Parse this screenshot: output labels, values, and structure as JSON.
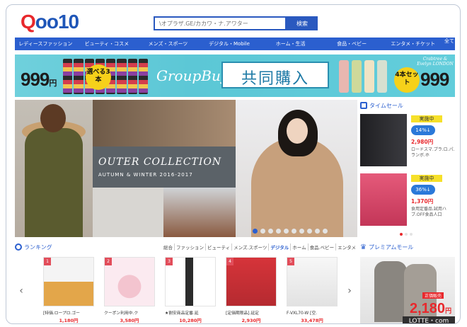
{
  "logo": {
    "q": "Q",
    "rest": "oo10"
  },
  "search": {
    "placeholder": "\\オプラザ.GE/カカワ・ナ.アワター",
    "button": "検索"
  },
  "nav": [
    "レディースファッション",
    "ビューティ・コスメ",
    "メンズ・スポーツ",
    "デジタル・Mobile",
    "ホーム・生活",
    "食品・ベビー",
    "エンタメ・チケット"
  ],
  "nav_more": "全て",
  "banner": {
    "price_left": "999",
    "price_unit": "円",
    "badge_left": "選べる3本",
    "groupbuy": "GroupBuy",
    "kyodo": "共同購入",
    "brand": "Crabtree & Evelyn LONDON",
    "badge_right": "4本セット",
    "price_right": "999"
  },
  "hero": {
    "title": "OUTER COLLECTION",
    "subtitle": "AUTUMN & WINTER 2016-2017",
    "slide_count": 10,
    "active_slide": 0
  },
  "timesale": {
    "title": "タイムセール",
    "items": [
      {
        "status": "実施中",
        "discount": "14%↓",
        "price": "2,980円",
        "desc": "ロードスマ.プラ.ロ.パ.ランボ.ホ"
      },
      {
        "status": "実施中",
        "discount": "36%↓",
        "price": "1,370円",
        "desc": "食用定番品.試用ハブ.OFF食品人口"
      }
    ]
  },
  "ranking": {
    "title": "ランキング",
    "categories": [
      "総合",
      "ファッション",
      "ビューティ",
      "メンズ.スポーツ",
      "デジタル",
      "ホーム",
      "食品.ベビー",
      "エンタメ"
    ],
    "active_category": 4,
    "items": [
      {
        "rank": "1",
        "name": "[特価.ロープロ.ゴー",
        "price": "1,180円"
      },
      {
        "rank": "2",
        "name": "クーポン利用中.ク",
        "price": "3,580円"
      },
      {
        "rank": "3",
        "name": "★割安商品定番.延",
        "price": "10,280円"
      },
      {
        "rank": "4",
        "name": "[定価期限品].延定",
        "price": "2,930円"
      },
      {
        "rank": "5",
        "name": "F-VXL70-W [空.",
        "price": "33,478円"
      }
    ]
  },
  "premium": {
    "title": "プレミアムモール",
    "label": "正価販売",
    "price": "2,180",
    "price_unit": "円",
    "brand": "LOTTE・com"
  }
}
